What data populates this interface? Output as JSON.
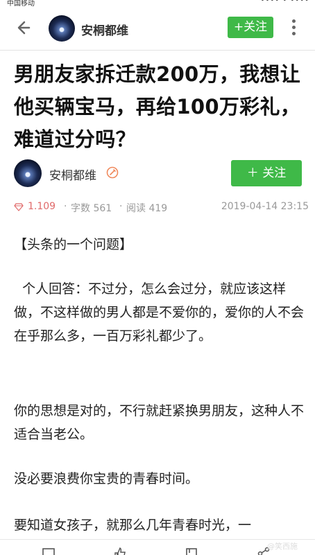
{
  "status": {
    "carrier": "中国移动",
    "right": "•••• • ••••"
  },
  "header": {
    "author_name": "安桐都维",
    "follow_label": "+关注"
  },
  "article": {
    "title": "男朋友家拆迁款200万，我想让他买辆宝马，再给100万彩礼，难道过分吗？",
    "author_name": "安桐都维",
    "follow_label": "＋ 关注",
    "meta": {
      "score": "1.109",
      "words": "字数 561",
      "reads": "阅读 419",
      "sep": "·",
      "date": "2019-04-14 23:15"
    },
    "paragraphs": [
      "【头条的一个问题】",
      "  个人回答：不过分，怎么会过分，就应该这样做，不这样做的男人都是不爱你的，爱你的人不会在乎那么多，一百万彩礼都少了。",
      "你的思想是对的，不行就赶紧换男朋友，这种人不适合当老公。",
      "没必要浪费你宝贵的青春时间。",
      "要知道女孩子，就那么几年青春时光，一"
    ]
  },
  "watermark": "@笑西施",
  "colors": {
    "accent_green": "#3fb948",
    "score_red": "#e06a6a",
    "meta_gray": "#999999"
  },
  "icons": [
    "back-arrow-icon",
    "more-vertical-icon",
    "verified-badge-icon",
    "gem-icon",
    "comment-icon",
    "like-icon",
    "bookmark-icon",
    "share-icon"
  ]
}
